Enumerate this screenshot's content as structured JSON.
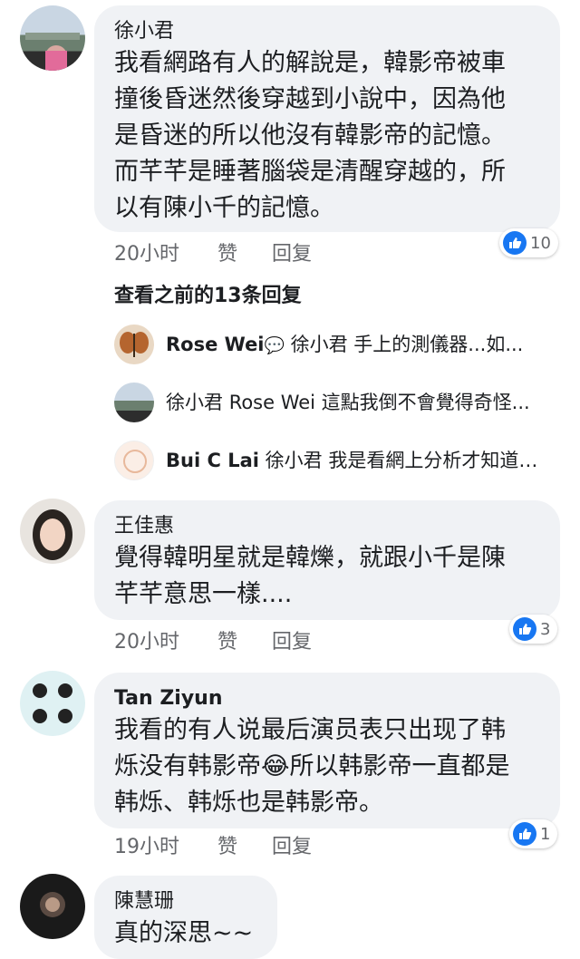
{
  "comments": [
    {
      "author": "徐小君",
      "text": "我看網路有人的解說是，韓影帝被車\n撞後昏迷然後穿越到小說中，因為他\n是昏迷的所以他沒有韓影帝的記憶。\n而芊芊是睡著腦袋是清醒穿越的，所\n以有陳小千的記憶。",
      "time": "20小时",
      "like": "赞",
      "reply": "回复",
      "reactions": "10"
    },
    {
      "author": "王佳惠",
      "text": "覺得韓明星就是韓爍，就跟小千是陳\n芊芊意思一樣....",
      "time": "20小时",
      "like": "赞",
      "reply": "回复",
      "reactions": "3"
    },
    {
      "author": "Tan Ziyun",
      "text": "我看的有人说最后演员表只出现了韩\n烁没有韩影帝😂所以韩影帝一直都是\n韩烁、韩烁也是韩影帝。",
      "time": "19小时",
      "like": "赞",
      "reply": "回复",
      "reactions": "1"
    },
    {
      "author": "陳慧珊",
      "text": "真的深思~~"
    }
  ],
  "view_previous": "查看之前的13条回复",
  "replies": [
    {
      "name": "Rose Wei",
      "text": "徐小君 手上的測儀器...如..."
    },
    {
      "name": "徐小君",
      "text": "Rose Wei 這點我倒不會覺得奇怪..."
    },
    {
      "name": "Bui C Lai",
      "text": "徐小君 我是看網上分析才知道…"
    }
  ],
  "colors": {
    "bubble": "#f0f2f5",
    "like_blue": "#1877f2",
    "meta_gray": "#65676b"
  }
}
